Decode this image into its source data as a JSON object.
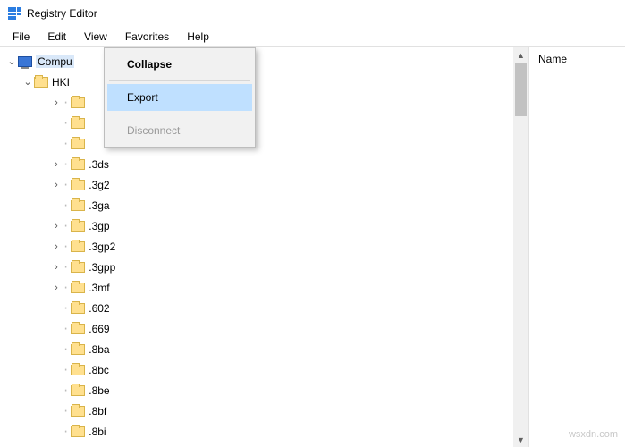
{
  "title": "Registry Editor",
  "menu": {
    "file": "File",
    "edit": "Edit",
    "view": "View",
    "favorites": "Favorites",
    "help": "Help"
  },
  "tree": {
    "root": "Compu",
    "hkey": "HKI",
    "items": [
      ".3ds",
      ".3g2",
      ".3ga",
      ".3gp",
      ".3gp2",
      ".3gpp",
      ".3mf",
      ".602",
      ".669",
      ".8ba",
      ".8bc",
      ".8be",
      ".8bf",
      ".8bi"
    ]
  },
  "ctx": {
    "collapse": "Collapse",
    "export": "Export",
    "disconnect": "Disconnect"
  },
  "right": {
    "name_col": "Name"
  },
  "watermark": "wsxdn.com",
  "glyph": {
    "down": "⌄",
    "right": "›"
  }
}
